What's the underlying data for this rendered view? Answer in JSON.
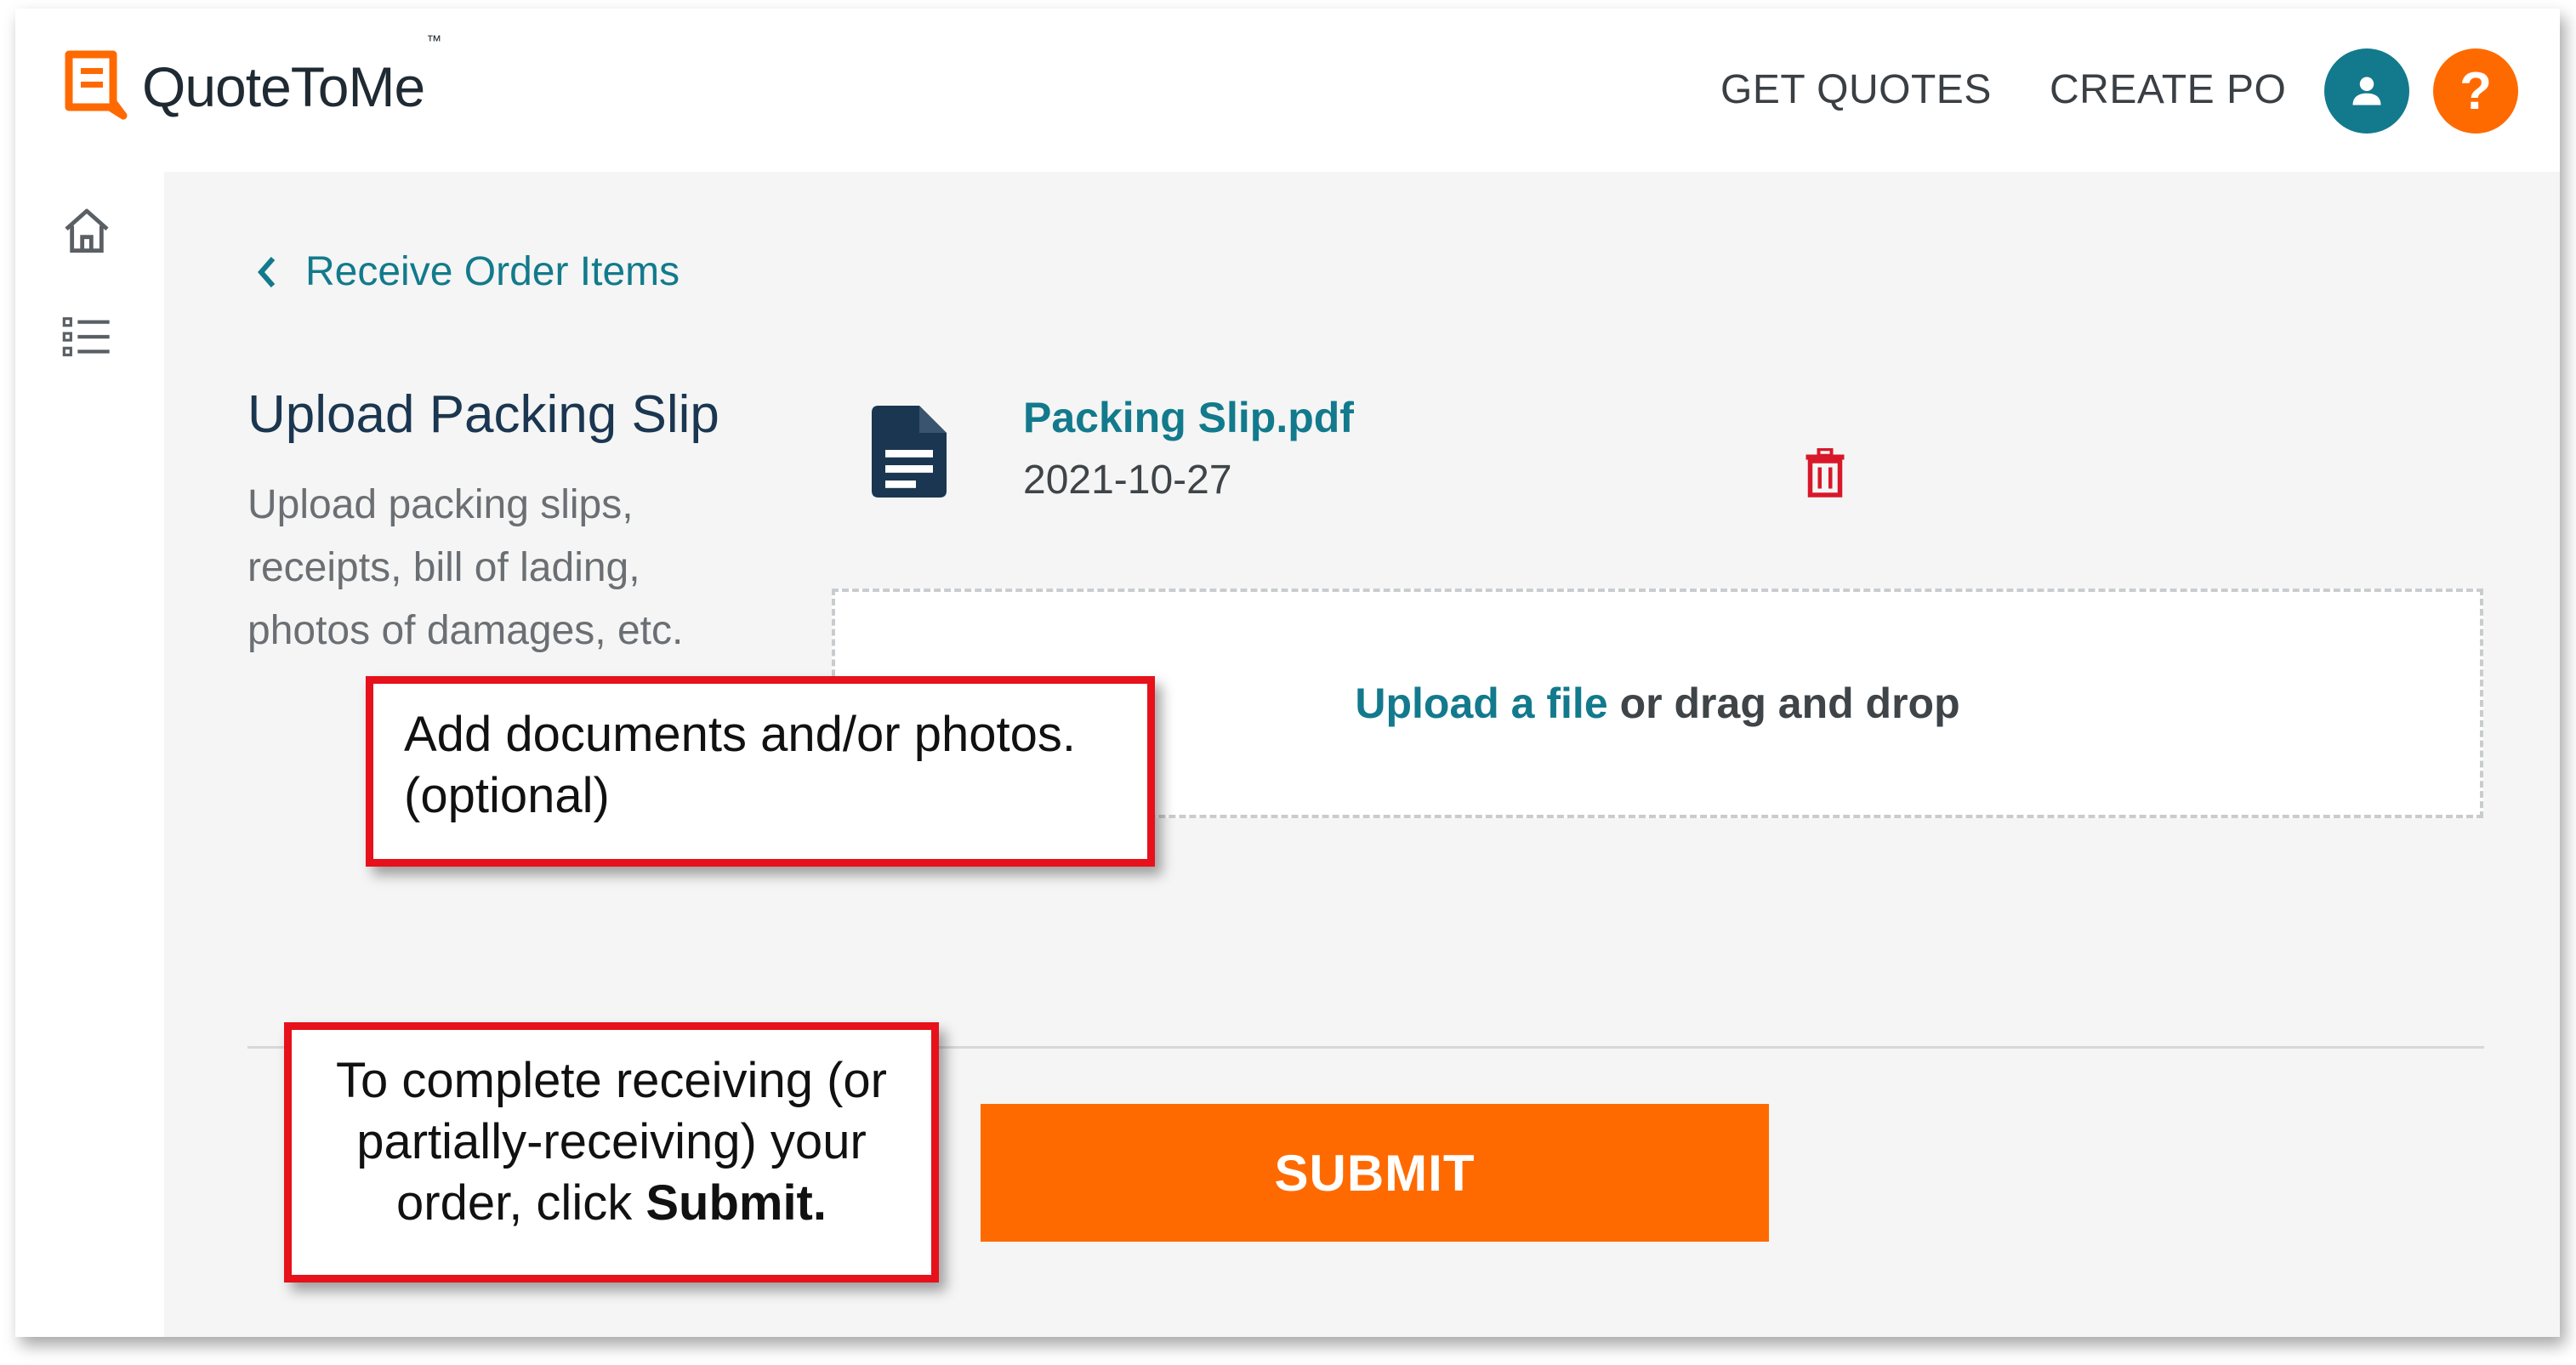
{
  "app": {
    "logo_text": "QuoteToMe",
    "logo_tm": "™"
  },
  "header": {
    "nav": [
      "GET QUOTES",
      "CREATE PO"
    ],
    "help_label": "?"
  },
  "breadcrumb": {
    "back_label": "Receive Order Items"
  },
  "section": {
    "title": "Upload Packing Slip",
    "description": "Upload packing slips, receipts, bill of lading, photos of damages, etc."
  },
  "file": {
    "name": "Packing Slip.pdf",
    "date": "2021-10-27"
  },
  "dropzone": {
    "link_text": "Upload a file",
    "rest_text": "or drag and drop"
  },
  "actions": {
    "submit_label": "SUBMIT"
  },
  "callouts": {
    "add_docs_line1": "Add documents and/or photos.",
    "add_docs_line2": "(optional)",
    "complete_line1": "To complete receiving (or partially-receiving) your order, click",
    "complete_bold": "Submit."
  },
  "colors": {
    "brand_orange": "#ff6a00",
    "teal": "#127a8c",
    "navy": "#1b3650",
    "callout_red": "#e6111a"
  }
}
